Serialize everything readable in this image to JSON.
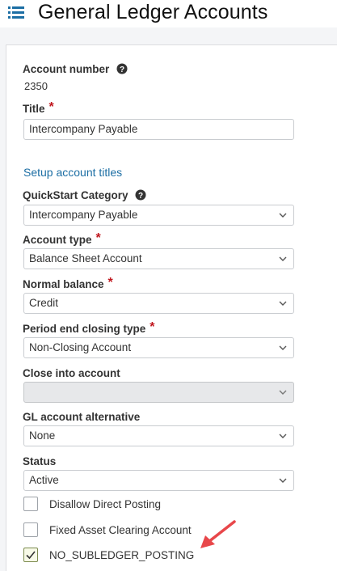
{
  "header": {
    "title": "General Ledger Accounts",
    "menu_icon": "list-menu-icon"
  },
  "form": {
    "account_number": {
      "label": "Account number",
      "value": "2350"
    },
    "title": {
      "label": "Title",
      "required_mark": "*",
      "value": "Intercompany Payable"
    },
    "setup_link": "Setup account titles",
    "quickstart_category": {
      "label": "QuickStart Category",
      "value": "Intercompany Payable"
    },
    "account_type": {
      "label": "Account type",
      "required_mark": "*",
      "value": "Balance Sheet Account"
    },
    "normal_balance": {
      "label": "Normal balance",
      "required_mark": "*",
      "value": "Credit"
    },
    "period_end_closing_type": {
      "label": "Period end closing type",
      "required_mark": "*",
      "value": "Non-Closing Account"
    },
    "close_into_account": {
      "label": "Close into account",
      "value": ""
    },
    "gl_account_alternative": {
      "label": "GL account alternative",
      "value": "None"
    },
    "status": {
      "label": "Status",
      "value": "Active"
    },
    "checkboxes": [
      {
        "label": "Disallow Direct Posting",
        "checked": false
      },
      {
        "label": "Fixed Asset Clearing Account",
        "checked": false
      },
      {
        "label": "NO_SUBLEDGER_POSTING",
        "checked": true
      }
    ]
  },
  "colors": {
    "required": "#c0161d",
    "link": "#1c6ea4",
    "annotation_arrow": "#e8474a",
    "menu_icon": "#1c6ea4"
  }
}
